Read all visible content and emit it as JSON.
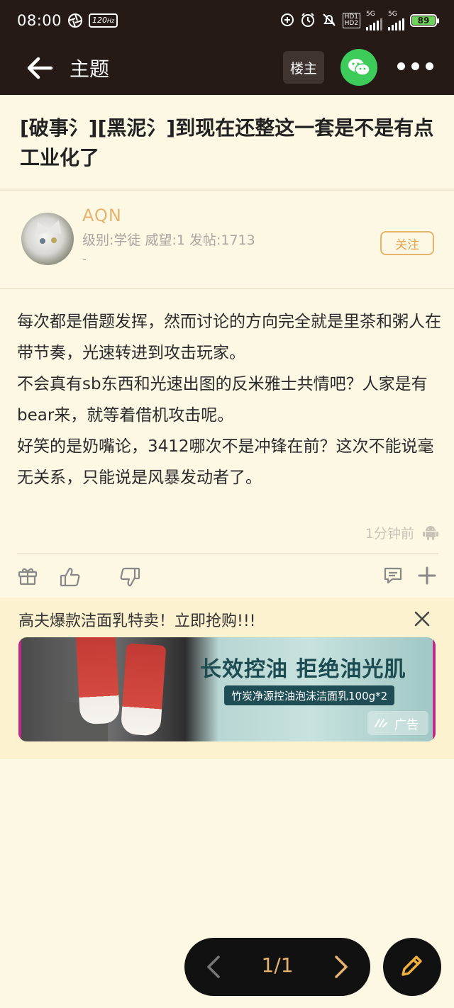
{
  "status_bar": {
    "time": "08:00",
    "refresh_rate": "120",
    "refresh_unit": "Hz",
    "hd_label_1": "HD1",
    "hd_label_2": "HD2",
    "network_1": "5G",
    "network_2": "5G",
    "battery": "89"
  },
  "header": {
    "title": "主题",
    "louzhu_label": "楼主",
    "back_icon": "arrow-left-icon",
    "share_icon": "wechat-icon",
    "more_icon": "more-dots-icon"
  },
  "post": {
    "title": "[破事氵][黑泥氵]到现在还整这一套是不是有点工业化了",
    "author": {
      "name": "AQN",
      "meta": "级别:学徒 威望:1 发帖:1713",
      "signature": "-",
      "follow_label": "关注"
    },
    "content": [
      "每次都是借题发挥，然而讨论的方向完全就是里茶和粥人在带节奏，光速转进到攻击玩家。",
      "不会真有sb东西和光速出图的反米雅士共情吧？人家是有bear来，就等着借机攻击呢。",
      "好笑的是奶嘴论，3412哪次不是冲锋在前？这次不能说毫无关系，只能说是风暴发动者了。"
    ],
    "time": "1分钟前",
    "device_icon": "android-icon"
  },
  "actions": {
    "gift_icon": "gift-icon",
    "like_icon": "thumbs-up-icon",
    "dislike_icon": "thumbs-down-icon",
    "comment_icon": "comment-icon",
    "add_icon": "plus-icon"
  },
  "ad": {
    "title": "高夫爆款洁面乳特卖！立即抢购!!!",
    "headline": "长效控油 拒绝油光肌",
    "subline": "竹炭净源控油泡沫洁面乳100g*2",
    "tag": "广告"
  },
  "pager": {
    "page": "1/1"
  },
  "colors": {
    "background": "#fdf8e3",
    "header": "#261a16",
    "accent": "#e6b36e",
    "wechat": "#3dcb5a"
  }
}
